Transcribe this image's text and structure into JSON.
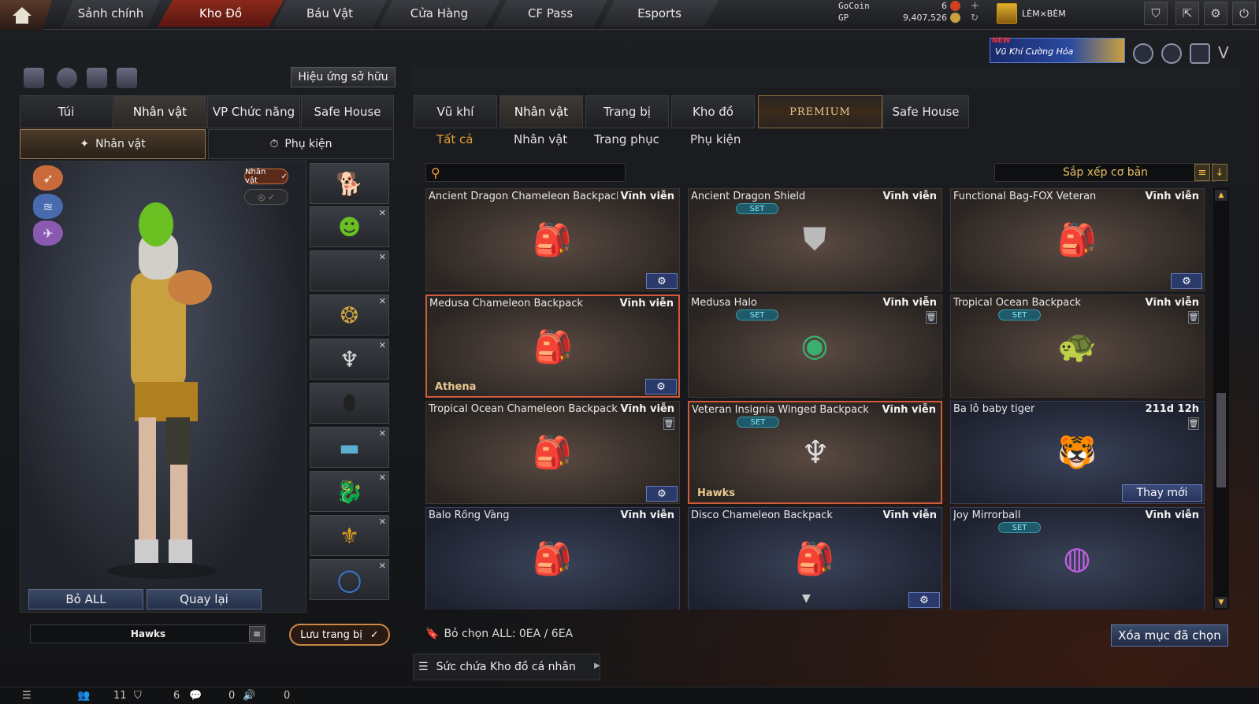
{
  "nav": {
    "tabs": [
      "Sảnh chính",
      "Kho Đồ",
      "Báu Vật",
      "Cửa Hàng",
      "CF Pass",
      "Esports"
    ]
  },
  "currency": {
    "gocoin_label": "GoCoin",
    "gp_label": "GP",
    "gocoin_value": "6",
    "gp_value": "9,407,526"
  },
  "user": {
    "name": "LÈM×BÈM"
  },
  "banner": {
    "new": "NEW",
    "text": "Vũ Khí Cường Hóa"
  },
  "left": {
    "effect_button": "Hiệu ứng sở hữu",
    "tabs": [
      "Túi",
      "Nhân vật",
      "VP Chức năng",
      "Safe House"
    ],
    "subtabs": [
      "Nhân vật",
      "Phụ kiện"
    ],
    "char_badge": "Nhân vật",
    "btn_remove_all": "Bỏ ALL",
    "btn_back": "Quay lại",
    "preset_name": "Hawks",
    "save_button": "Lưu trang bị"
  },
  "right": {
    "tabs": [
      "Vũ khí",
      "Nhân vật",
      "Trang bị",
      "Kho đồ",
      "PREMIUM",
      "Safe House"
    ],
    "subtabs": [
      "Tất cả",
      "Nhân vật",
      "Trang phục",
      "Phụ kiện"
    ],
    "search_placeholder": "",
    "sort_label": "Sắp xếp cơ bản",
    "set_label": "SET",
    "items": [
      {
        "name": "Ancient Dragon Chameleon Backpack",
        "duration": "Vĩnh viễn"
      },
      {
        "name": "Ancient Dragon Shield",
        "duration": "Vĩnh viễn"
      },
      {
        "name": "Functional Bag-FOX Veteran",
        "duration": "Vĩnh viễn"
      },
      {
        "name": "Medusa Chameleon Backpack",
        "duration": "Vĩnh viễn",
        "owner": "Athena"
      },
      {
        "name": "Medusa Halo",
        "duration": "Vĩnh viễn"
      },
      {
        "name": "Tropical Ocean Backpack",
        "duration": "Vĩnh viễn"
      },
      {
        "name": "Tropical Ocean Chameleon Backpack",
        "duration": "Vĩnh viễn"
      },
      {
        "name": "Veteran Insignia Winged Backpack",
        "duration": "Vĩnh viễn",
        "owner": "Hawks"
      },
      {
        "name": "Ba lô baby tiger",
        "duration": "211d 12h",
        "renew": "Thay mới"
      },
      {
        "name": "Balo Rồng Vàng",
        "duration": "Vĩnh viễn"
      },
      {
        "name": "Disco Chameleon Backpack",
        "duration": "Vĩnh viễn"
      },
      {
        "name": "Joy Mirrorball",
        "duration": "Vĩnh viễn"
      }
    ],
    "selection_info": "Bỏ chọn ALL: 0EA / 6EA",
    "delete_selected": "Xóa mục đã chọn",
    "capacity": "Sức chứa Kho đồ cá nhân"
  },
  "status": {
    "v1": "11",
    "v2": "6",
    "v3": "0",
    "v4": "0"
  },
  "colors": {
    "accent": "#e8a030",
    "active_tab": "#8a2a1a",
    "selected_border": "#d05a3a"
  }
}
